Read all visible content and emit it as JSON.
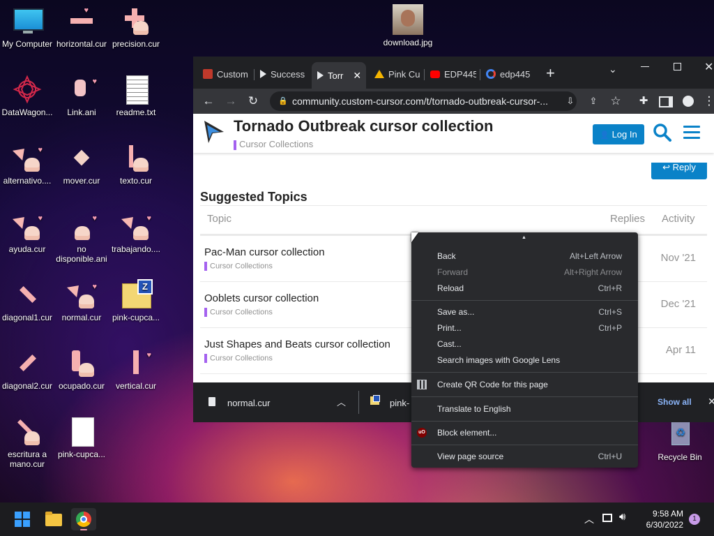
{
  "desktop": {
    "icons": [
      {
        "label": "My Computer"
      },
      {
        "label": "horizontal.cur"
      },
      {
        "label": "precision.cur"
      },
      {
        "label": "download.jpg"
      },
      {
        "label": "DataWagon..."
      },
      {
        "label": "Link.ani"
      },
      {
        "label": "readme.txt"
      },
      {
        "label": "alternativo...."
      },
      {
        "label": "mover.cur"
      },
      {
        "label": "texto.cur"
      },
      {
        "label": "ayuda.cur"
      },
      {
        "label": "no disponible.ani"
      },
      {
        "label": "trabajando...."
      },
      {
        "label": "diagonal1.cur"
      },
      {
        "label": "normal.cur"
      },
      {
        "label": "pink-cupca..."
      },
      {
        "label": "diagonal2.cur"
      },
      {
        "label": "ocupado.cur"
      },
      {
        "label": "vertical.cur"
      },
      {
        "label": "escritura a mano.cur"
      },
      {
        "label": "pink-cupca..."
      },
      {
        "label": "Recycle Bin"
      }
    ]
  },
  "browser": {
    "tabs": [
      {
        "label": "Custom",
        "icon": "custom-cursor-favicon"
      },
      {
        "label": "Success",
        "icon": "cursor-favicon"
      },
      {
        "label": "Torr",
        "icon": "cursor-favicon"
      },
      {
        "label": "Pink Cu",
        "icon": "drive-favicon"
      },
      {
        "label": "EDP445",
        "icon": "youtube-favicon"
      },
      {
        "label": "edp445",
        "icon": "google-favicon"
      }
    ],
    "url": "community.custom-cursor.com/t/tornado-outbreak-cursor-...",
    "page": {
      "title": "Tornado Outbreak cursor collection",
      "category": "Cursor Collections",
      "login_label": "Log In",
      "reply_label": "Reply",
      "suggested_heading": "Suggested Topics",
      "columns": {
        "topic": "Topic",
        "replies": "Replies",
        "activity": "Activity"
      },
      "topics": [
        {
          "title": "Pac-Man cursor collection",
          "category": "Cursor Collections",
          "activity": "Nov '21"
        },
        {
          "title": "Ooblets cursor collection",
          "category": "Cursor Collections",
          "activity": "Dec '21"
        },
        {
          "title": "Just Shapes and Beats cursor collection",
          "category": "Cursor Collections",
          "activity": "Apr 11"
        }
      ]
    },
    "downloads": {
      "items": [
        {
          "name": "normal.cur"
        },
        {
          "name": "pink-"
        }
      ],
      "show_all": "Show all"
    }
  },
  "context_menu": {
    "items": [
      {
        "label": "Back",
        "shortcut": "Alt+Left Arrow"
      },
      {
        "label": "Forward",
        "shortcut": "Alt+Right Arrow"
      },
      {
        "label": "Reload",
        "shortcut": "Ctrl+R"
      },
      {
        "label": "Save as...",
        "shortcut": "Ctrl+S"
      },
      {
        "label": "Print...",
        "shortcut": "Ctrl+P"
      },
      {
        "label": "Cast..."
      },
      {
        "label": "Search images with Google Lens"
      },
      {
        "label": "Create QR Code for this page"
      },
      {
        "label": "Translate to English"
      },
      {
        "label": "Block element..."
      },
      {
        "label": "View page source",
        "shortcut": "Ctrl+U"
      }
    ]
  },
  "taskbar": {
    "time": "9:58 AM",
    "date": "6/30/2022",
    "notification_count": "1"
  }
}
